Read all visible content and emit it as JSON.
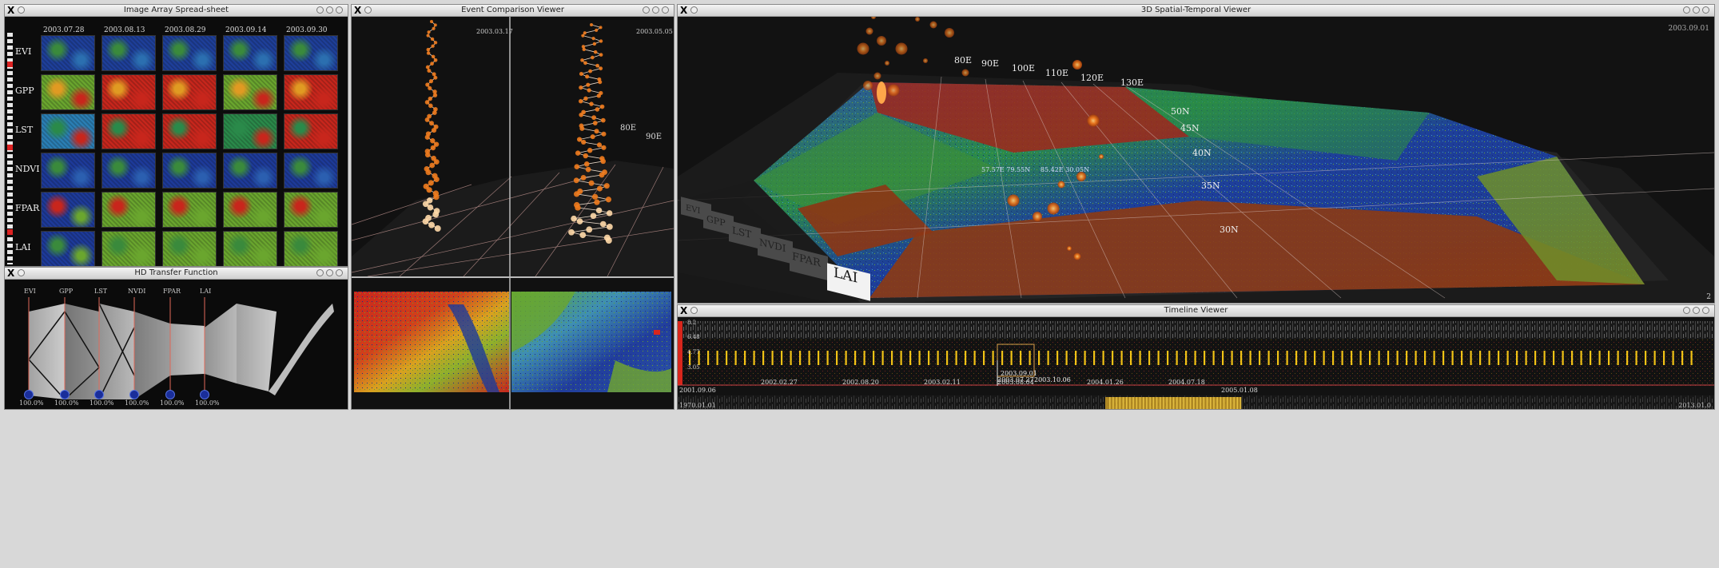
{
  "windows": {
    "spreadsheet": {
      "title": "Image Array Spread-sheet"
    },
    "transfer": {
      "title": "HD Transfer Function"
    },
    "comparison": {
      "title": "Event Comparison Viewer"
    },
    "viewer3d": {
      "title": "3D Spatial-Temporal Viewer"
    },
    "timeline": {
      "title": "Timeline Viewer"
    }
  },
  "spreadsheet": {
    "dates": [
      "2003.07.28",
      "2003.08.13",
      "2003.08.29",
      "2003.09.14",
      "2003.09.30"
    ],
    "variables": [
      "EVI",
      "GPP",
      "LST",
      "NDVI",
      "FPAR",
      "LAI"
    ]
  },
  "transfer": {
    "axes": [
      "EVI",
      "GPP",
      "LST",
      "NVDI",
      "FPAR",
      "LAI"
    ],
    "percents": [
      "100.0%",
      "100.0%",
      "100.0%",
      "100.0%",
      "100.0%",
      "100.0%"
    ]
  },
  "comparison": {
    "left_date": "2003.03.17",
    "right_date": "2003.05.05",
    "lon_labels": [
      "80E",
      "90E"
    ]
  },
  "viewer3d": {
    "date": "2003.09.01",
    "lon_labels": [
      "80E",
      "90E",
      "100E",
      "110E",
      "120E",
      "130E"
    ],
    "lat_labels": [
      "50N",
      "45N",
      "40N",
      "35N",
      "30N"
    ],
    "layer_tiles": [
      "EVI",
      "GPP",
      "LST",
      "NVDI",
      "FPAR",
      "LAI"
    ],
    "coord_label": "57.57E 79.55N     85.42E 30.05N",
    "corner_digit": "2"
  },
  "timeline": {
    "y_values": [
      "8.2",
      "6.48",
      "4.77",
      "3.05"
    ],
    "dates": [
      "2001.09.06",
      "2002.02.27",
      "2002.08.20",
      "2003.02.11",
      "2003.08.04",
      "2004.01.26",
      "2004.07.18",
      "2005.01.08"
    ],
    "highlight_dates": [
      "2003.09.01",
      "2003.07.27",
      "2003.10.06"
    ],
    "overview_start": "1970.01.01",
    "overview_end": "2013.01.0"
  },
  "colors": {
    "bg": "#111111",
    "red": "#d8261c",
    "green": "#6aa62e",
    "blue": "#1e3f9a",
    "orange": "#f07b1d",
    "yellow": "#f2c316"
  }
}
